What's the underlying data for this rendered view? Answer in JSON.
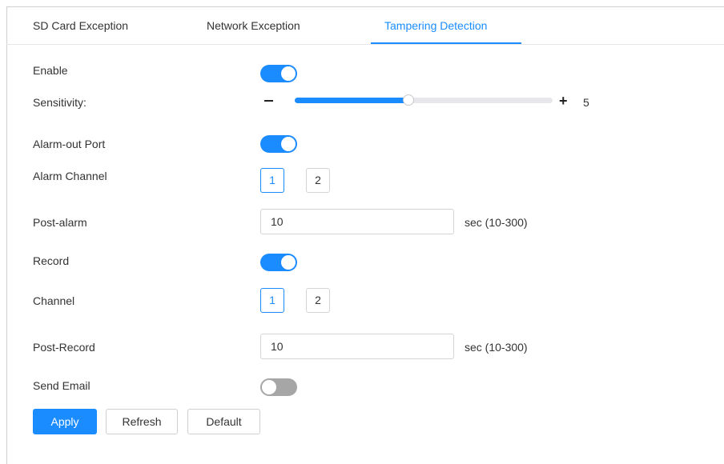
{
  "tabs": [
    {
      "label": "SD Card Exception",
      "active": false
    },
    {
      "label": "Network Exception",
      "active": false
    },
    {
      "label": "Tampering Detection",
      "active": true
    }
  ],
  "colors": {
    "accent": "#1a8cff",
    "toggle_off": "#a6a6a6",
    "border": "#d4d4d4"
  },
  "form": {
    "enable": {
      "label": "Enable",
      "on": true
    },
    "sensitivity": {
      "label": "Sensitivity:",
      "value": "5",
      "min": 1,
      "max": 10,
      "level": 0.44
    },
    "alarm_out_port": {
      "label": "Alarm-out Port",
      "on": true
    },
    "alarm_channel": {
      "label": "Alarm Channel",
      "options": [
        "1",
        "2"
      ],
      "selected": "1"
    },
    "post_alarm": {
      "label": "Post-alarm",
      "value": "10",
      "unit": "sec (10-300)"
    },
    "record": {
      "label": "Record",
      "on": true
    },
    "channel": {
      "label": "Channel",
      "options": [
        "1",
        "2"
      ],
      "selected": "1"
    },
    "post_record": {
      "label": "Post-Record",
      "value": "10",
      "unit": "sec (10-300)"
    },
    "send_email": {
      "label": "Send Email",
      "on": false
    }
  },
  "buttons": {
    "apply": "Apply",
    "refresh": "Refresh",
    "default": "Default"
  },
  "icons": {
    "minus": "minus-icon",
    "plus": "plus-icon"
  }
}
